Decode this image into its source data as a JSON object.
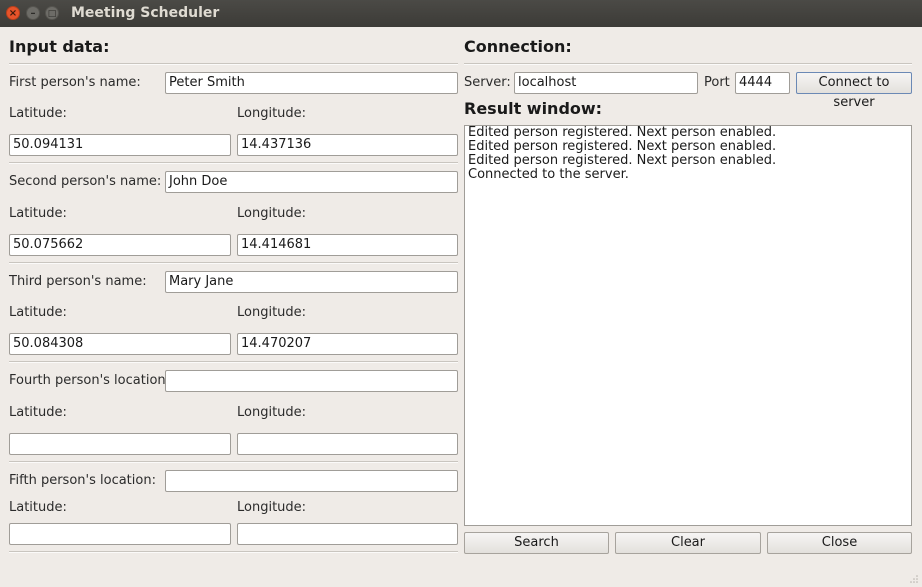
{
  "window": {
    "title": "Meeting Scheduler",
    "close_glyph": "×",
    "min_glyph": "–",
    "max_glyph": "□"
  },
  "input": {
    "header": "Input data:",
    "lat_label": "Latitude:",
    "lon_label": "Longitude:",
    "persons": [
      {
        "name_label": "First person's name:",
        "name": "Peter Smith",
        "latitude": "50.094131",
        "longitude": "14.437136"
      },
      {
        "name_label": "Second person's name:",
        "name": "John Doe",
        "latitude": "50.075662",
        "longitude": "14.414681"
      },
      {
        "name_label": "Third person's name:",
        "name": "Mary Jane",
        "latitude": "50.084308",
        "longitude": "14.470207"
      },
      {
        "name_label": "Fourth person's location:",
        "name": "",
        "latitude": "",
        "longitude": ""
      },
      {
        "name_label": "Fifth person's location:",
        "name": "",
        "latitude": "",
        "longitude": ""
      }
    ]
  },
  "connection": {
    "header": "Connection:",
    "server_label": "Server:",
    "server": "localhost",
    "port_label": "Port",
    "port": "4444",
    "connect_label": "Connect to server"
  },
  "result": {
    "header": "Result window:",
    "lines": [
      "Edited person registered. Next person enabled.",
      "Edited person registered. Next person enabled.",
      "Edited person registered. Next person enabled.",
      "Connected to the server."
    ]
  },
  "actions": {
    "search_label": "Search",
    "clear_label": "Clear",
    "close_label": "Close"
  }
}
